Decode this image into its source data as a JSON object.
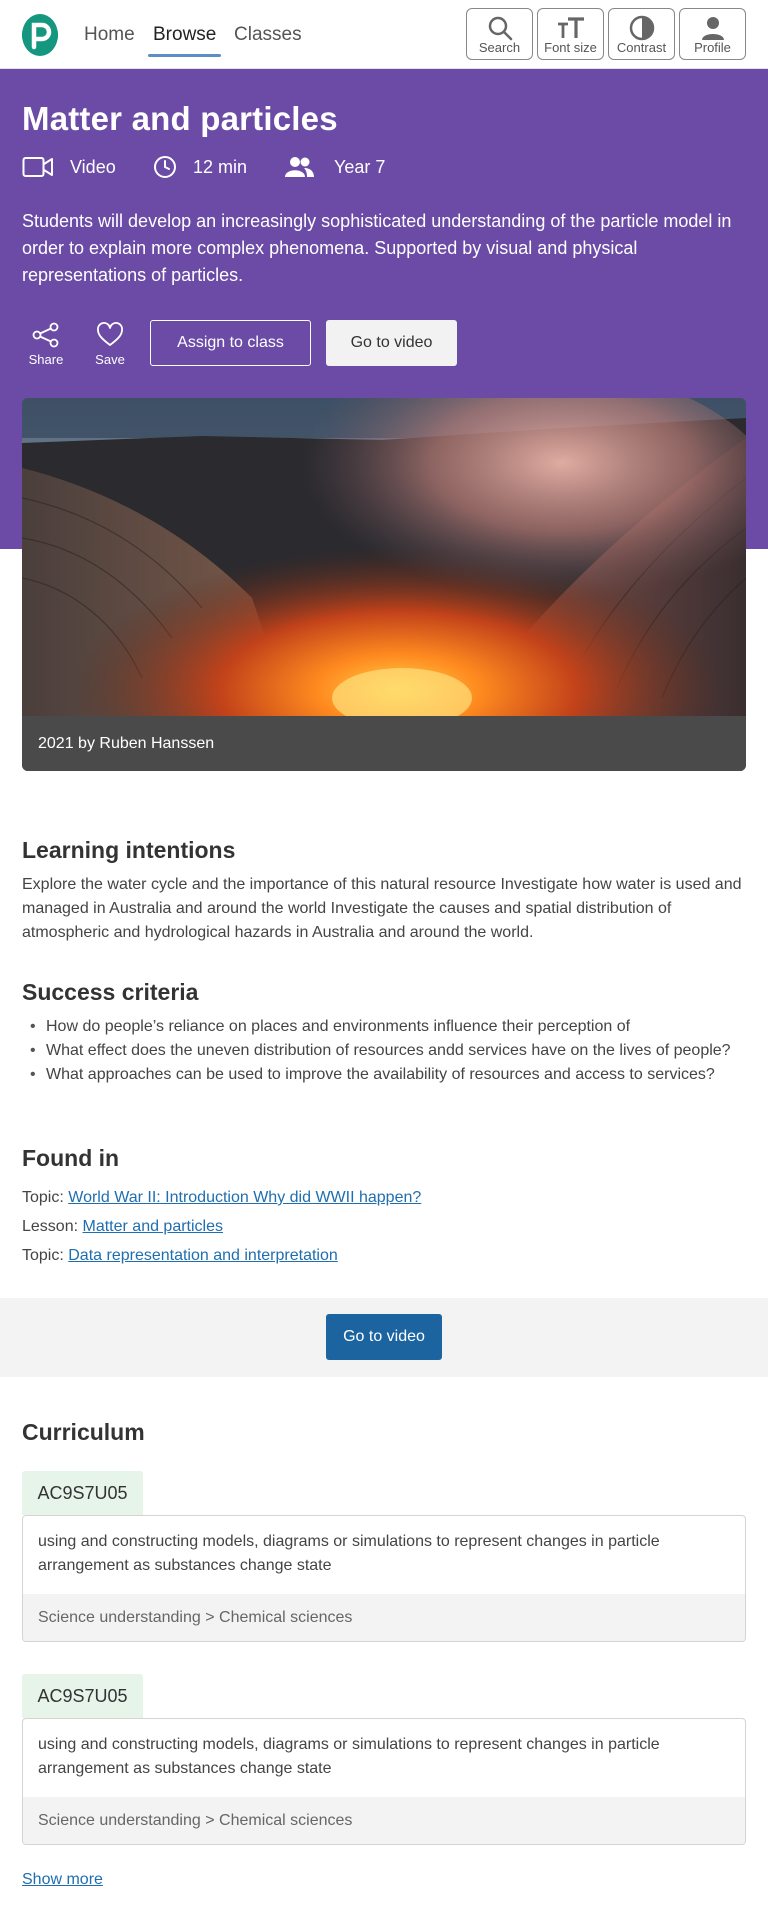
{
  "nav": {
    "items": [
      "Home",
      "Browse",
      "Classes"
    ],
    "active": "Browse"
  },
  "tools": {
    "search": "Search",
    "font_size": "Font size",
    "contrast": "Contrast",
    "profile": "Profile"
  },
  "resource": {
    "title": "Matter and particles",
    "type": "Video",
    "duration": "12 min",
    "year": "Year 7",
    "description": "Students will develop an increasingly sophisticated understanding of the particle model in order to explain more complex phenomena. Supported by visual and physical representations of particles.",
    "share_label": "Share",
    "save_label": "Save",
    "assign_label": "Assign to class",
    "go_video_label": "Go to video",
    "image_caption": "2021 by Ruben Hanssen"
  },
  "learning_intentions": {
    "heading": "Learning intentions",
    "text": "Explore the water cycle and the importance of this natural resource Investigate how water is used and managed in Australia and around the world Investigate the causes and spatial distribution of atmospheric and hydrological hazards in Australia and around the world."
  },
  "success_criteria": {
    "heading": "Success criteria",
    "items": [
      "How do people’s reliance on places and environments influence their perception of",
      "What effect does the uneven distribution of resources andd services have on the lives of people?",
      "What approaches can be used to improve the availability of resources and access to services?"
    ]
  },
  "found_in": {
    "heading": "Found in",
    "entries": [
      {
        "kind": "Topic:",
        "link": "World War II: Introduction Why did WWII happen?"
      },
      {
        "kind": "Lesson:",
        "link": "Matter and particles"
      },
      {
        "kind": "Topic:",
        "link": "Data representation and interpretation"
      }
    ]
  },
  "cta": {
    "go_video_label": "Go to video"
  },
  "curriculum": {
    "heading": "Curriculum",
    "items": [
      {
        "code": "AC9S7U05",
        "text": "using and constructing models, diagrams or simulations to represent changes in particle arrangement as substances change state",
        "path": "Science understanding > Chemical sciences"
      },
      {
        "code": "AC9S7U05",
        "text": "using and constructing models, diagrams or simulations to represent changes in particle arrangement as substances change state",
        "path": "Science understanding > Chemical sciences"
      }
    ],
    "show_more": "Show more"
  },
  "colors": {
    "hero": "#6b4ba6",
    "logo": "#14967f",
    "primary_button": "#1b64a0",
    "link": "#1f6eb0",
    "code_badge": "#e6f4ea"
  }
}
